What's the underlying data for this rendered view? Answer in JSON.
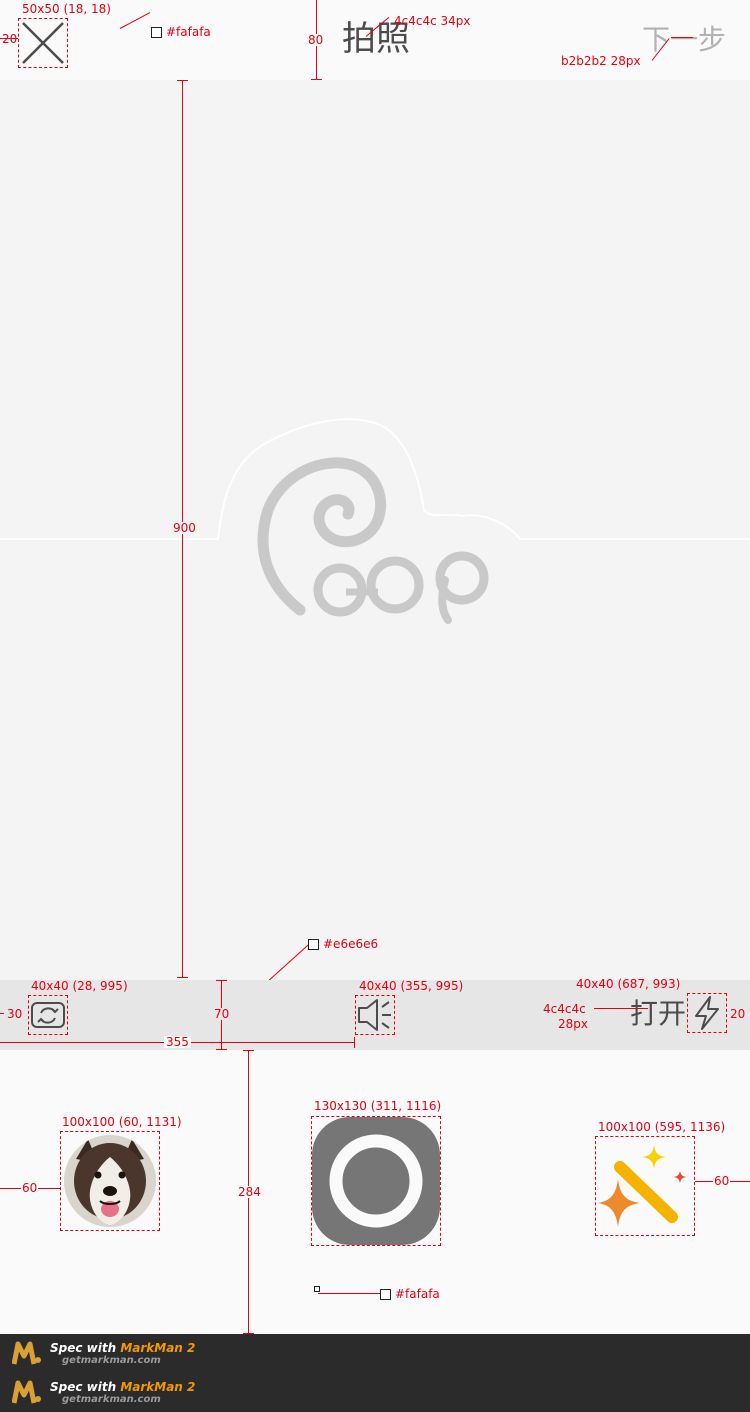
{
  "header": {
    "title": "拍照",
    "next_label": "下一步",
    "close_icon": "close-icon",
    "bg_color": "#fafafa"
  },
  "camera": {
    "bg_color": "#f4f4f4",
    "placeholder_logo": "goop-logo"
  },
  "toolbar": {
    "bg_color": "#e6e6e6",
    "flash_label": "打开",
    "switch_icon": "switch-camera-icon",
    "sound_icon": "speaker-icon",
    "flash_icon": "lightning-icon"
  },
  "bottom": {
    "bg_color": "#fafafa",
    "gallery_thumb": "dog-photo",
    "shutter_icon": "shutter-button",
    "effects_icon": "magic-wand-icon"
  },
  "annotations": {
    "close_spec": "50x50 (18, 18)",
    "close_margin": "20",
    "header_color": "#fafafa",
    "title_spec": "4c4c4c  34px",
    "header_height": "80",
    "next_spec": "b2b2b2  28px",
    "camera_height": "900",
    "toolbar_color": "#e6e6e6",
    "switch_spec": "40x40 (28, 995)",
    "switch_margin": "30",
    "toolbar_height": "70",
    "sound_spec": "40x40 (355, 995)",
    "sound_offset": "355",
    "flash_spec": "40x40 (687, 993)",
    "flash_text_spec_color": "4c4c4c",
    "flash_text_spec_size": "28px",
    "flash_margin": "20",
    "gallery_spec": "100x100 (60, 1131)",
    "gallery_margin": "60",
    "shutter_spec": "130x130 (311, 1116)",
    "bottom_height": "284",
    "effects_spec": "100x100 (595, 1136)",
    "effects_margin": "60",
    "bottom_color": "#fafafa"
  },
  "footer": {
    "brand_prefix": "Spec with",
    "brand_name": "MarkMan 2",
    "brand_url": "getmarkman.com"
  }
}
